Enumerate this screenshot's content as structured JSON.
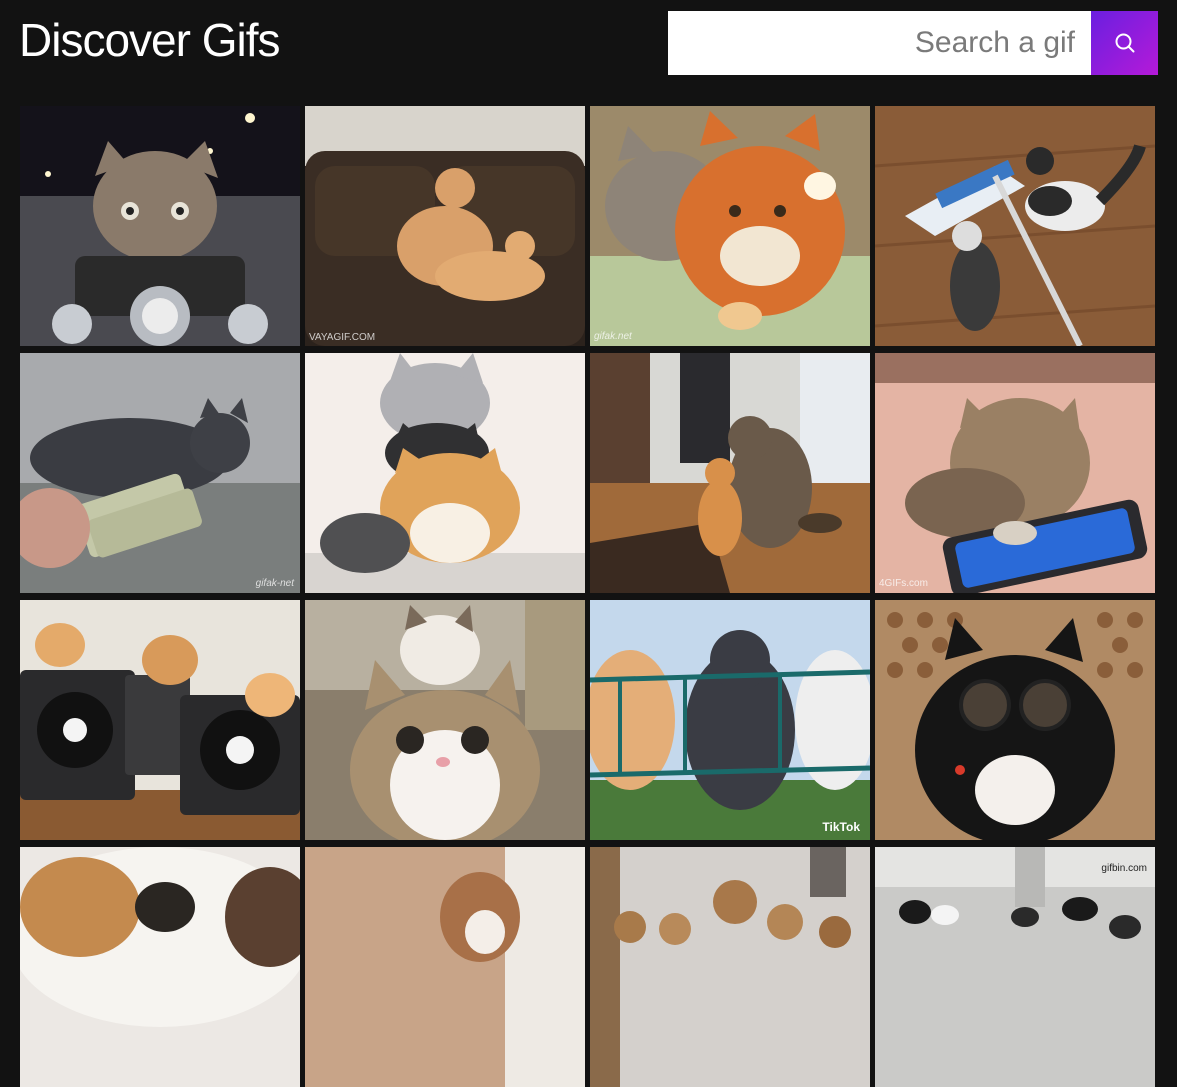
{
  "header": {
    "title": "Discover Gifs",
    "search": {
      "placeholder": "Search a gif",
      "button_icon": "search-icon"
    }
  },
  "gifs": [
    {
      "subject": "kitten riding motorcycle at night"
    },
    {
      "subject": "two orange cats on leather couch",
      "watermark": "VAYAGIF.COM"
    },
    {
      "subject": "tabby and orange cat cuddling",
      "watermark": "gifak.net"
    },
    {
      "subject": "kitten chasing mop"
    },
    {
      "subject": "grey cat with money stack",
      "watermark": "gifak-net"
    },
    {
      "subject": "three cats stacked"
    },
    {
      "subject": "cat and kitten hugging on floor"
    },
    {
      "subject": "kitten playing tablet",
      "watermark": "4GIFs.com"
    },
    {
      "subject": "kittens on DJ turntables"
    },
    {
      "subject": "two cats close-up"
    },
    {
      "subject": "cats hanging on railing",
      "watermark": "TikTok"
    },
    {
      "subject": "black cat with glasses"
    },
    {
      "subject": "calico cat close-up"
    },
    {
      "subject": "kitten by window"
    },
    {
      "subject": "group of kittens"
    },
    {
      "subject": "cats in hallway",
      "watermark": "gifbin.com"
    }
  ],
  "colors": {
    "background": "#121212",
    "title": "#ffffff",
    "search_button_start": "#6a1fe0",
    "search_button_end": "#b51ad8"
  }
}
